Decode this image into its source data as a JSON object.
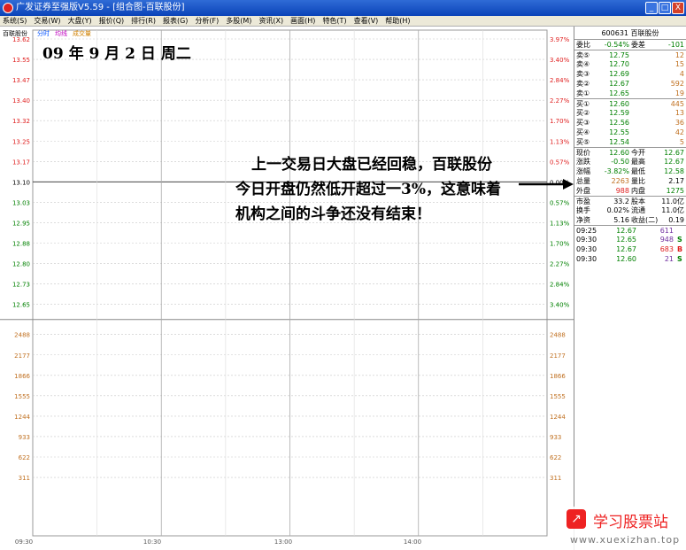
{
  "window": {
    "title": "广发证券至强版V5.59 - [组合图-百联股份]",
    "buttons": [
      "_",
      "□",
      "X"
    ]
  },
  "menu": [
    "系统(S)",
    "交易(W)",
    "大盘(Y)",
    "报价(Q)",
    "排行(R)",
    "报表(G)",
    "分析(F)",
    "多股(M)",
    "资讯(X)",
    "画面(H)",
    "特色(T)",
    "查看(V)",
    "帮助(H)"
  ],
  "chart": {
    "stock_label": "百联股份",
    "tabs": [
      "分时",
      "均线",
      "成交量"
    ],
    "tab_colors": [
      "#0050ff",
      "#c000c0",
      "#d08000"
    ],
    "price_ticks": [
      "13.62",
      "13.55",
      "13.47",
      "13.40",
      "13.32",
      "13.25",
      "13.17",
      "13.10",
      "13.03",
      "12.95",
      "12.88",
      "12.80",
      "12.73",
      "12.65"
    ],
    "pct_ticks": [
      "3.97%",
      "3.40%",
      "2.84%",
      "2.27%",
      "1.70%",
      "1.13%",
      "0.57%",
      "0.00%",
      "0.57%",
      "1.13%",
      "1.70%",
      "2.27%",
      "2.84%",
      "3.40%"
    ],
    "vol_ticks": [
      "2488",
      "2177",
      "1866",
      "1555",
      "1244",
      "933",
      "622",
      "311"
    ],
    "time_ticks": [
      "09:30",
      "10:30",
      "13:00",
      "14:00"
    ],
    "colors": {
      "up": "#e02020",
      "neutral": "#000000",
      "down": "#008000",
      "grid": "#c8c8c8"
    }
  },
  "annotation": {
    "date": "09 年 9 月 2 日    周二",
    "comment": "上一交易日大盘已经回稳，百联股份今日开盘仍然低开超过一3%，这意味着机构之间的斗争还没有结束！"
  },
  "quote": {
    "header": "600631 百联股份",
    "weibi": {
      "label": "委比",
      "value": "-0.54%",
      "label2": "委差",
      "value2": "-101"
    },
    "sell": [
      {
        "label": "卖⑤",
        "price": "12.75",
        "vol": "12"
      },
      {
        "label": "卖④",
        "price": "12.70",
        "vol": "15"
      },
      {
        "label": "卖③",
        "price": "12.69",
        "vol": "4"
      },
      {
        "label": "卖②",
        "price": "12.67",
        "vol": "592"
      },
      {
        "label": "卖①",
        "price": "12.65",
        "vol": "19"
      }
    ],
    "buy": [
      {
        "label": "买①",
        "price": "12.60",
        "vol": "445"
      },
      {
        "label": "买②",
        "price": "12.59",
        "vol": "13"
      },
      {
        "label": "买③",
        "price": "12.56",
        "vol": "36"
      },
      {
        "label": "买④",
        "price": "12.55",
        "vol": "42"
      },
      {
        "label": "买⑤",
        "price": "12.54",
        "vol": "5"
      }
    ],
    "stats": [
      {
        "l1": "现价",
        "v1": "12.60",
        "l2": "今开",
        "v2": "12.67"
      },
      {
        "l1": "涨跌",
        "v1": "-0.50",
        "l2": "最高",
        "v2": "12.67"
      },
      {
        "l1": "涨幅",
        "v1": "-3.82%",
        "l2": "最低",
        "v2": "12.58"
      },
      {
        "l1": "总量",
        "v1": "2263",
        "l2": "量比",
        "v2": "2.17"
      },
      {
        "l1": "外盘",
        "v1": "988",
        "l2": "内盘",
        "v2": "1275"
      }
    ],
    "fundamentals": [
      {
        "l1": "市盈",
        "v1": "33.2",
        "l2": "股本",
        "v2": "11.0亿"
      },
      {
        "l1": "换手",
        "v1": "0.02%",
        "l2": "流通",
        "v2": "11.0亿"
      },
      {
        "l1": "净资",
        "v1": "5.16",
        "l2": "收益(二)",
        "v2": "0.19"
      }
    ],
    "ticks": [
      {
        "time": "09:25",
        "price": "12.67",
        "vol": "611",
        "side": ""
      },
      {
        "time": "09:30",
        "price": "12.65",
        "vol": "948",
        "side": "S"
      },
      {
        "time": "09:30",
        "price": "12.67",
        "vol": "683",
        "side": "B"
      },
      {
        "time": "09:30",
        "price": "12.60",
        "vol": "21",
        "side": "S"
      }
    ]
  },
  "watermark": {
    "mark": "↗",
    "text": "学习股票站",
    "url": "www.xuexizhan.top"
  }
}
